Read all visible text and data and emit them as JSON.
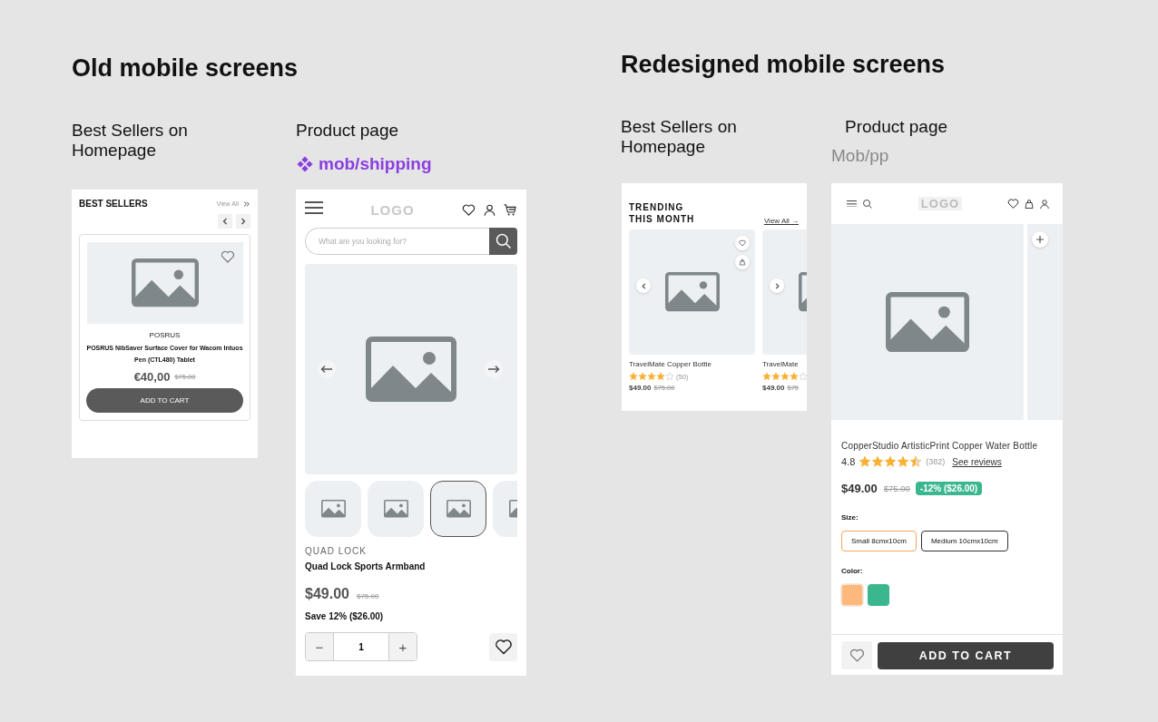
{
  "old_screens": {
    "title": "Old mobile screens",
    "best_sellers": {
      "caption": "Best Sellers on Homepage",
      "heading": "BEST SELLERS",
      "view_all": "View All",
      "product": {
        "brand": "POSRUS",
        "name": "POSRUS NibSaver Surface Cover for Wacom Intuos Pen (CTL480) Tablet",
        "price": "€40,00",
        "old_price": "$75.00",
        "button": "ADD TO CART"
      }
    },
    "product_page": {
      "caption": "Product page",
      "component": "mob/shipping",
      "logo": "LOGO",
      "search_placeholder": "What are you looking for?",
      "thumbnails": [
        {
          "selected": false
        },
        {
          "selected": false
        },
        {
          "selected": true
        },
        {
          "selected": false
        }
      ],
      "brand": "QUAD LOCK",
      "name": "Quad Lock Sports Armband",
      "price": "$49.00",
      "old_price": "$75.00",
      "savings": "Save 12% ($26.00)",
      "decrease": "−",
      "quantity": "1",
      "increase": "+"
    }
  },
  "new_screens": {
    "title": "Redesigned mobile screens",
    "best_sellers": {
      "caption": "Best Sellers on Homepage",
      "heading": "TRENDING THIS MONTH",
      "view_all": "View All →",
      "products": [
        {
          "name": "TravelMate Copper Bottle",
          "stars": 4,
          "reviews": "(50)",
          "price": "$49.00",
          "old_price": "$75.00"
        },
        {
          "name": "TravelMate",
          "stars": 4,
          "price": "$49.00",
          "old_price": "$75"
        }
      ]
    },
    "product_page": {
      "caption": "Product page",
      "frame_name": "Mob/pp",
      "logo": "LOGO",
      "name": "CopperStudio ArtisticPrint Copper Water Bottle",
      "rating": "4.8",
      "stars": 4.5,
      "reviews": "(382)",
      "see_reviews": "See reviews",
      "price": "$49.00",
      "old_price": "$75.00",
      "discount": "-12% ($26.00)",
      "size_label": "Size:",
      "sizes": [
        {
          "label": "Small 8cmx10cm",
          "selected": true
        },
        {
          "label": "Medium 10cmx10cm",
          "selected": false
        }
      ],
      "color_label": "Color:",
      "colors": [
        {
          "color": "#fdb97d",
          "selected": true
        },
        {
          "color": "#3bb78f",
          "selected": false
        }
      ],
      "button": "ADD TO CART"
    }
  }
}
